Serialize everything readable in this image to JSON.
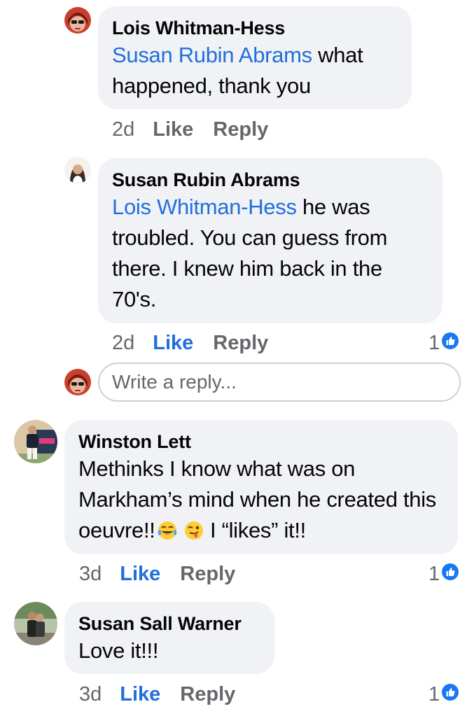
{
  "comments": [
    {
      "author": "Lois Whitman-Hess",
      "mention": "Susan Rubin Abrams",
      "text": " what happened, thank you",
      "time": "2d",
      "like_label": "Like",
      "reply_label": "Reply",
      "liked": false
    },
    {
      "author": "Susan Rubin Abrams",
      "mention": "Lois Whitman-Hess",
      "text": " he was troubled. You can guess from there. I knew him back in the 70's.",
      "time": "2d",
      "like_label": "Like",
      "reply_label": "Reply",
      "liked": true,
      "reactions": "1"
    },
    {
      "author": "Winston Lett",
      "text": "Methinks I know what was on Markham’s mind when he created this oeuvre!!",
      "text_after_emoji": " I “likes” it!!",
      "emojis": [
        "laughing-tears-emoji",
        "winking-tongue-emoji"
      ],
      "time": "3d",
      "like_label": "Like",
      "reply_label": "Reply",
      "liked": true,
      "reactions": "1"
    },
    {
      "author": "Susan Sall Warner",
      "text": "Love it!!!",
      "time": "3d",
      "like_label": "Like",
      "reply_label": "Reply",
      "liked": true,
      "reactions": "1"
    }
  ],
  "reply_box": {
    "placeholder": "Write a reply..."
  },
  "colors": {
    "link": "#216fdb",
    "bubble": "#f0f2f5",
    "secondary_text": "#65676b",
    "like_icon": "#1877f2"
  }
}
